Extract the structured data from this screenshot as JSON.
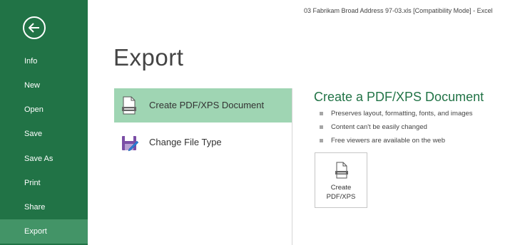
{
  "window": {
    "title": "03 Fabrikam Broad Address 97-03.xls  [Compatibility Mode] - Excel"
  },
  "sidebar": {
    "back_icon": "arrow-left-circle-icon",
    "items": [
      {
        "label": "Info"
      },
      {
        "label": "New"
      },
      {
        "label": "Open"
      },
      {
        "label": "Save"
      },
      {
        "label": "Save As"
      },
      {
        "label": "Print"
      },
      {
        "label": "Share"
      },
      {
        "label": "Export",
        "active": true
      }
    ]
  },
  "main": {
    "title": "Export",
    "options": [
      {
        "label": "Create PDF/XPS Document",
        "icon": "pdf-document-icon",
        "selected": true
      },
      {
        "label": "Change File Type",
        "icon": "change-file-type-icon",
        "selected": false
      }
    ]
  },
  "detail": {
    "title": "Create a PDF/XPS Document",
    "bullets": [
      "Preserves layout, formatting, fonts, and images",
      "Content can't be easily changed",
      "Free viewers are available on the web"
    ],
    "button": {
      "line1": "Create",
      "line2": "PDF/XPS",
      "icon": "pdf-xps-icon"
    }
  },
  "colors": {
    "accent": "#217346",
    "active_nav": "#439467",
    "selected_option": "#9fd5b3"
  }
}
